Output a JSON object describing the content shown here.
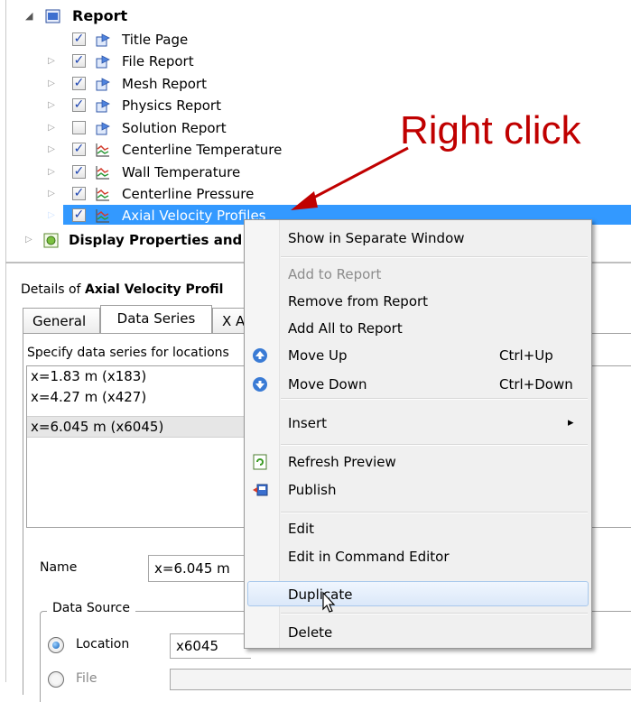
{
  "tree": {
    "root_label": "Report",
    "items": [
      {
        "label": "Title Page",
        "checked": true,
        "icon": "report-item-icon",
        "expandable": false
      },
      {
        "label": "File Report",
        "checked": true,
        "icon": "report-item-icon",
        "expandable": true
      },
      {
        "label": "Mesh Report",
        "checked": true,
        "icon": "report-item-icon",
        "expandable": true
      },
      {
        "label": "Physics Report",
        "checked": true,
        "icon": "report-item-icon",
        "expandable": true
      },
      {
        "label": "Solution Report",
        "checked": false,
        "icon": "report-item-icon",
        "expandable": true
      },
      {
        "label": "Centerline Temperature",
        "checked": true,
        "icon": "chart-icon",
        "expandable": true
      },
      {
        "label": "Wall Temperature",
        "checked": true,
        "icon": "chart-icon",
        "expandable": true
      },
      {
        "label": "Centerline Pressure",
        "checked": true,
        "icon": "chart-icon",
        "expandable": true
      },
      {
        "label": "Axial Velocity Profiles",
        "checked": true,
        "icon": "chart-icon",
        "expandable": true,
        "selected": true
      }
    ],
    "display_properties_label": "Display Properties and"
  },
  "details": {
    "prefix": "Details of ",
    "object": "Axial Velocity Profil",
    "tabs": [
      "General",
      "Data Series",
      "X A"
    ],
    "active_tab": "Data Series",
    "instruction": "Specify data series for locations",
    "series": [
      "x=1.83 m (x183)",
      "x=4.27 m (x427)",
      "x=6.045 m (x6045)"
    ],
    "name_label": "Name",
    "name_value": "x=6.045 m",
    "data_source_label": "Data Source",
    "location_label": "Location",
    "location_value": "x6045",
    "file_label": "File"
  },
  "menu": {
    "items": [
      {
        "label": "Show in Separate Window"
      },
      {
        "label": "Add to Report",
        "disabled": true
      },
      {
        "label": "Remove from Report"
      },
      {
        "label": "Add All to Report"
      },
      {
        "label": "Move Up",
        "shortcut": "Ctrl+Up",
        "icon": "arrow-up-icon"
      },
      {
        "label": "Move Down",
        "shortcut": "Ctrl+Down",
        "icon": "arrow-down-icon"
      },
      {
        "label": "Insert",
        "submenu": true
      },
      {
        "label": "Refresh Preview",
        "icon": "refresh-icon"
      },
      {
        "label": "Publish",
        "icon": "publish-icon"
      },
      {
        "label": "Edit"
      },
      {
        "label": "Edit in Command Editor"
      },
      {
        "label": "Duplicate",
        "highlighted": true
      },
      {
        "label": "Delete"
      }
    ],
    "submenu_arrow": "▸"
  },
  "annotation": {
    "text": "Right click",
    "color": "#c00000"
  },
  "colors": {
    "selection": "#3399ff",
    "annotation": "#c00000",
    "menu_bg": "#f0f0f0"
  }
}
